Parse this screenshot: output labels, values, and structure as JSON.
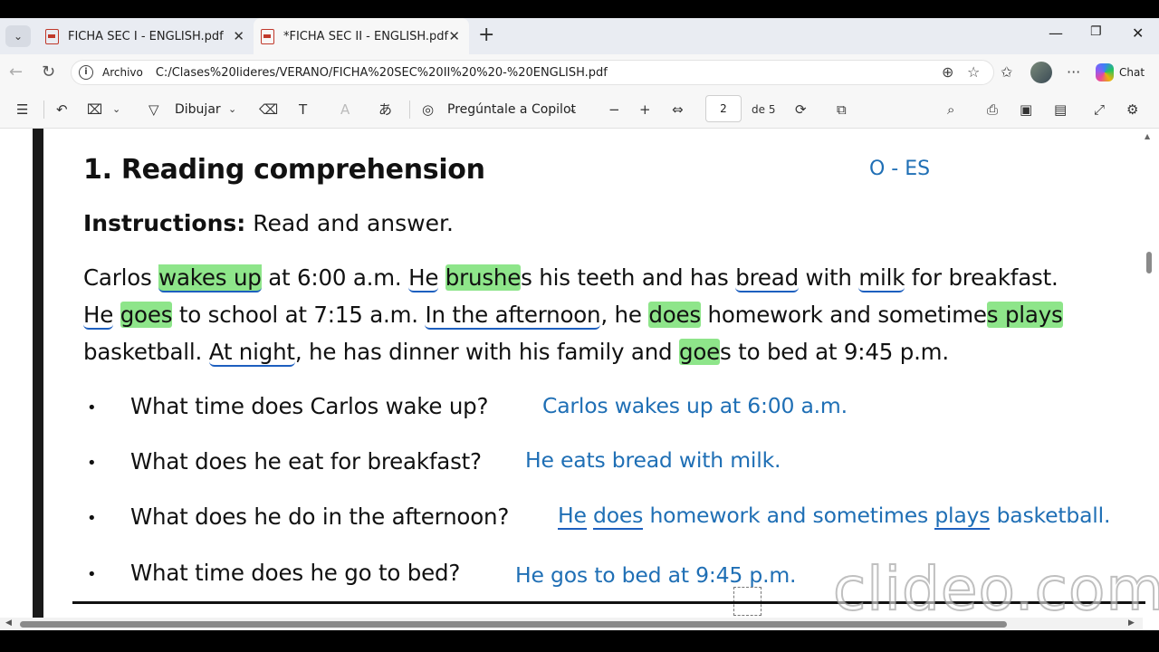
{
  "tabs": [
    {
      "title": "FICHA SEC I - ENGLISH.pdf",
      "active": false
    },
    {
      "title": "*FICHA SEC II - ENGLISH.pdf",
      "active": true
    }
  ],
  "addressbar": {
    "scheme_label": "Archivo",
    "url": "C:/Clases%20lideres/VERANO/FICHA%20SEC%20II%20%20-%20ENGLISH.pdf",
    "chat_label": "Chat"
  },
  "pdf_toolbar": {
    "draw_label": "Dibujar",
    "copilot_label": "Pregúntale a Copilot",
    "page_current": "2",
    "page_total_label": "de 5"
  },
  "document": {
    "heading": "1. Reading comprehension",
    "annotation_oes": "O - ES",
    "instructions_label": "Instructions:",
    "instructions_text": "Read and answer.",
    "paragraph": {
      "line1": [
        "Carlos ",
        "wakes up",
        " at 6:00 a.m. ",
        "He",
        " ",
        "brushe",
        "s his teeth and has ",
        "bread",
        " with ",
        "milk",
        " for breakfast."
      ],
      "line2": [
        "He",
        " ",
        "goes",
        " to school at 7:15 a.m. ",
        "In the afternoon",
        ", he ",
        "does",
        " homework and sometime",
        "s plays"
      ],
      "line3": [
        "basketball. ",
        "At night",
        ", he has dinner with his family and ",
        "goe",
        "s to bed at 9:45 p.m."
      ]
    },
    "questions": [
      {
        "bullet": "•",
        "q": "What time does Carlos wake up?",
        "a": "Carlos wakes up at 6:00 a.m."
      },
      {
        "bullet": "•",
        "q": "What does he eat for breakfast?",
        "a": "He eats bread with milk."
      },
      {
        "bullet": "•",
        "q": "What does he do in the afternoon?",
        "a_parts": [
          "He",
          " ",
          "does",
          " homework and sometimes ",
          "plays",
          " basketball."
        ]
      },
      {
        "bullet": "•",
        "q": "What time does he go to bed?",
        "a": "He gos to bed at 9:45 p.m."
      }
    ]
  },
  "watermark": "clideo.com",
  "colors": {
    "highlight": "#8ee58a",
    "ink_blue": "#1f6fb5",
    "underline_blue": "#1d5fbf"
  }
}
